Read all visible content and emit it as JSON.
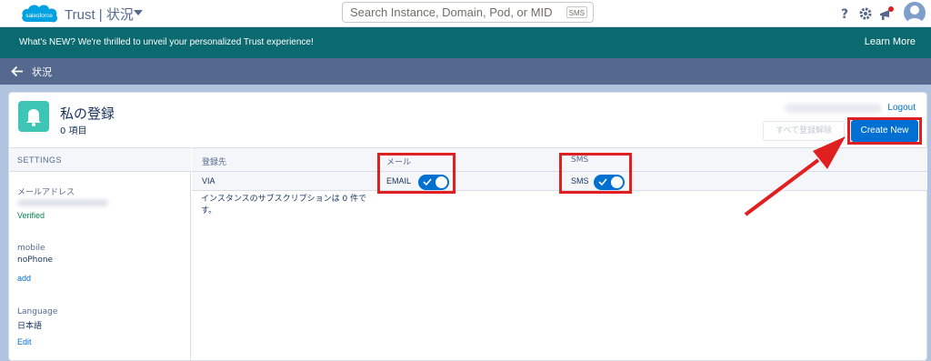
{
  "header": {
    "logo_text": "salesforce",
    "brand": "Trust | 状況",
    "search_placeholder": "Search Instance, Domain, Pod, or MID",
    "search_button": "SMS",
    "icons": [
      "help-icon",
      "gear-icon",
      "notifications-icon",
      "avatar"
    ]
  },
  "banner": {
    "text": "What's NEW? We're thrilled to unveil your personalized Trust experience!",
    "link": "Learn More"
  },
  "breadcrumb": {
    "label": "状況"
  },
  "card": {
    "title": "私の登録",
    "subtitle": "0 項目",
    "logout": "Logout",
    "unsubscribe_all": "すべて登録解除",
    "create_new": "Create New"
  },
  "settings": {
    "header": "SETTINGS",
    "email_label": "メールアドレス",
    "email_status": "Verified",
    "mobile_label": "mobile",
    "mobile_value": "noPhone",
    "mobile_action": "add",
    "language_label": "Language",
    "language_value": "日本語",
    "language_action": "Edit"
  },
  "table": {
    "columns": [
      "登録先",
      "メール",
      "SMS"
    ],
    "via_row": {
      "name": "VIA",
      "email_toggle_label": "EMAIL",
      "email_toggle_on": true,
      "sms_toggle_label": "SMS",
      "sms_toggle_on": true
    },
    "empty_note": "インスタンスのサブスクリプションは 0 件です。"
  },
  "colors": {
    "brand_blue": "#0070d2",
    "banner_teal": "#0b6a6f",
    "crumb_bar": "#54698d",
    "annotation_red": "#e02020",
    "bell_tile": "#3dc6b6"
  }
}
